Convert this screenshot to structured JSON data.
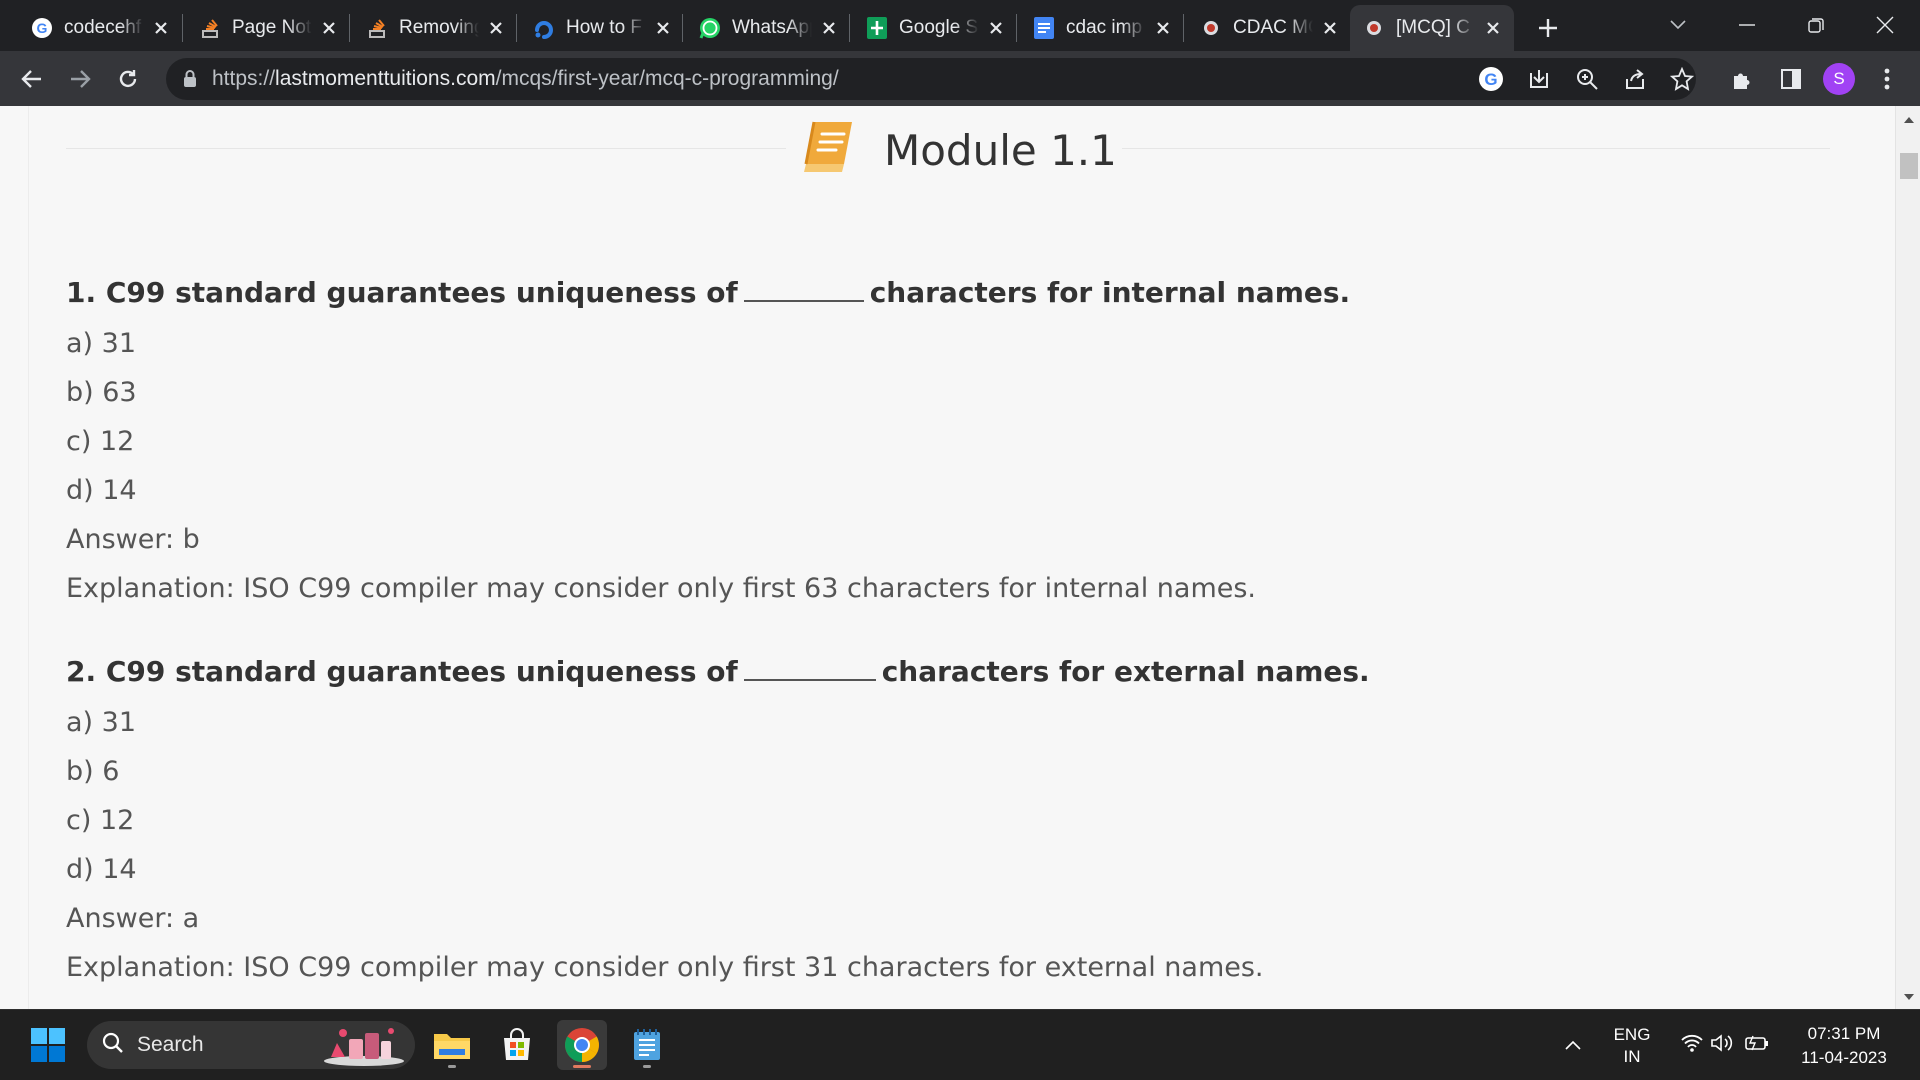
{
  "browser": {
    "tabs": [
      {
        "title": "codecehf",
        "icon": "google-g-icon"
      },
      {
        "title": "Page Not",
        "icon": "stackoverflow-icon"
      },
      {
        "title": "Removing",
        "icon": "stackoverflow-icon"
      },
      {
        "title": "How to F",
        "icon": "blue-spiral-icon"
      },
      {
        "title": "WhatsApp",
        "icon": "whatsapp-icon"
      },
      {
        "title": "Google S",
        "icon": "google-sheets-icon"
      },
      {
        "title": "cdac imp",
        "icon": "google-docs-icon"
      },
      {
        "title": "CDAC MC",
        "icon": "site-favicon"
      },
      {
        "title": "[MCQ] C",
        "icon": "site-favicon",
        "active": true
      }
    ],
    "url_scheme": "https://",
    "url_host": "lastmomenttuitions.com",
    "url_path": "/mcqs/first-year/mcq-c-programming/",
    "profile_initial": "S"
  },
  "page": {
    "module_title": "Module 1.1",
    "questions": [
      {
        "prefix": "1. C99 standard guarantees uniqueness of",
        "suffix": "characters for internal names.",
        "options": [
          "a) 31",
          "b) 63",
          "c) 12",
          "d) 14"
        ],
        "answer": "Answer: b",
        "explanation": "Explanation: ISO C99 compiler may consider only first 63 characters for internal names."
      },
      {
        "prefix": "2. C99 standard guarantees uniqueness of",
        "suffix": "characters for external names.",
        "options": [
          "a) 31",
          "b) 6",
          "c) 12",
          "d) 14"
        ],
        "answer": "Answer: a",
        "explanation": "Explanation: ISO C99 compiler may consider only first 31 characters for external names."
      }
    ]
  },
  "taskbar": {
    "search_label": "Search",
    "language_line1": "ENG",
    "language_line2": "IN",
    "time": "07:31 PM",
    "date": "11-04-2023"
  },
  "colors": {
    "tab_strip": "#202124",
    "toolbar": "#35363a",
    "page_bg": "#f7f7f7",
    "module_icon": "#f0a93b",
    "avatar": "#a142f4"
  }
}
